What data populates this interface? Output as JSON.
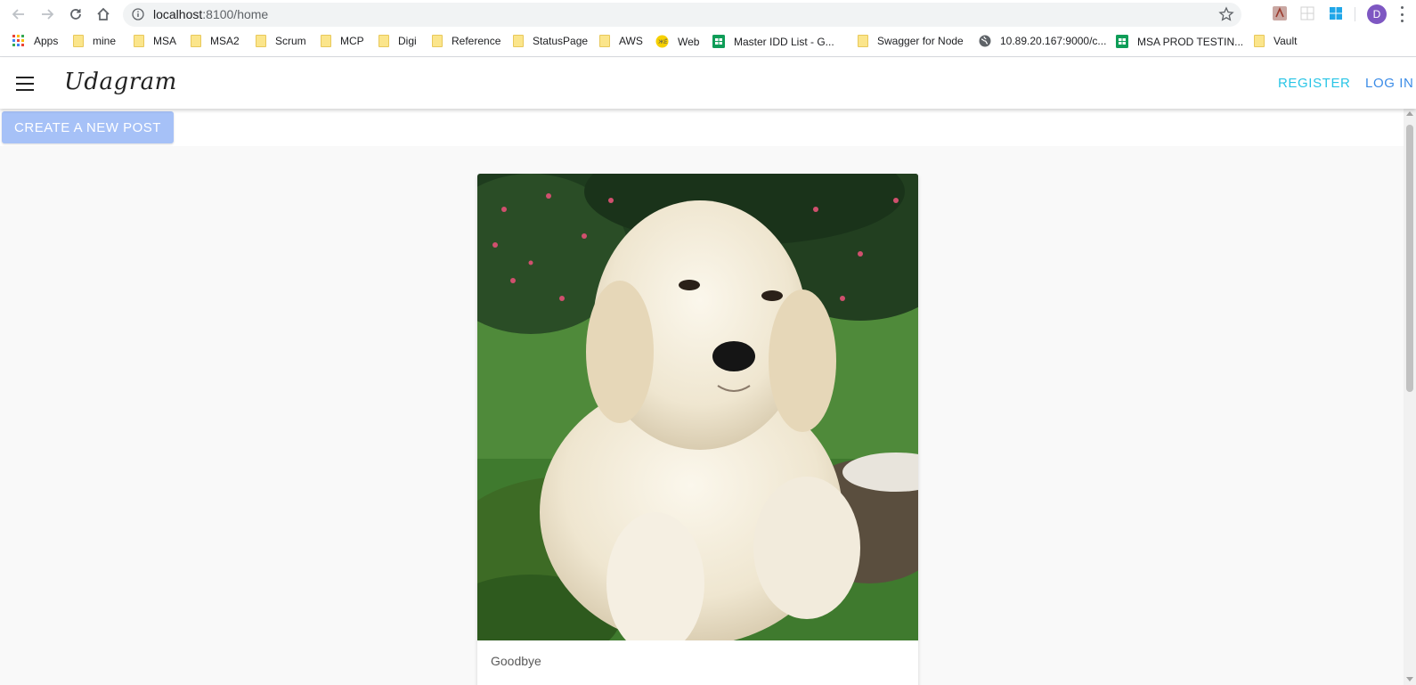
{
  "browser": {
    "url_host": "localhost",
    "url_path": ":8100/home",
    "profile_initial": "D",
    "bookmarks": [
      {
        "label": "Apps",
        "icon": "apps-grid-icon"
      },
      {
        "label": "mine",
        "icon": "folder-icon"
      },
      {
        "label": "MSA",
        "icon": "folder-icon"
      },
      {
        "label": "MSA2",
        "icon": "folder-icon"
      },
      {
        "label": "Scrum",
        "icon": "folder-icon"
      },
      {
        "label": "MCP",
        "icon": "folder-icon"
      },
      {
        "label": "Digi",
        "icon": "folder-icon"
      },
      {
        "label": "Reference",
        "icon": "folder-icon"
      },
      {
        "label": "StatusPage",
        "icon": "folder-icon"
      },
      {
        "label": "AWS",
        "icon": "folder-icon"
      },
      {
        "label": "Web",
        "icon": "web-favicon-icon"
      },
      {
        "label": "Master IDD List - G...",
        "icon": "sheets-icon"
      },
      {
        "label": "Swagger for Node",
        "icon": "folder-icon"
      },
      {
        "label": "10.89.20.167:9000/c...",
        "icon": "globe-icon"
      },
      {
        "label": "MSA PROD TESTIN...",
        "icon": "sheets-icon"
      },
      {
        "label": "Vault",
        "icon": "folder-icon"
      }
    ]
  },
  "app": {
    "brand": "Udagram",
    "register_label": "REGISTER",
    "login_label": "LOG IN",
    "create_post_label": "CREATE A NEW POST",
    "feed": [
      {
        "caption": "Goodbye",
        "image": "golden-retriever-puppy-photo"
      }
    ]
  },
  "colors": {
    "register": "#29c5e6",
    "login": "#3c8ce7",
    "create_button": "#a6c1f7",
    "profile": "#7e57c2"
  }
}
